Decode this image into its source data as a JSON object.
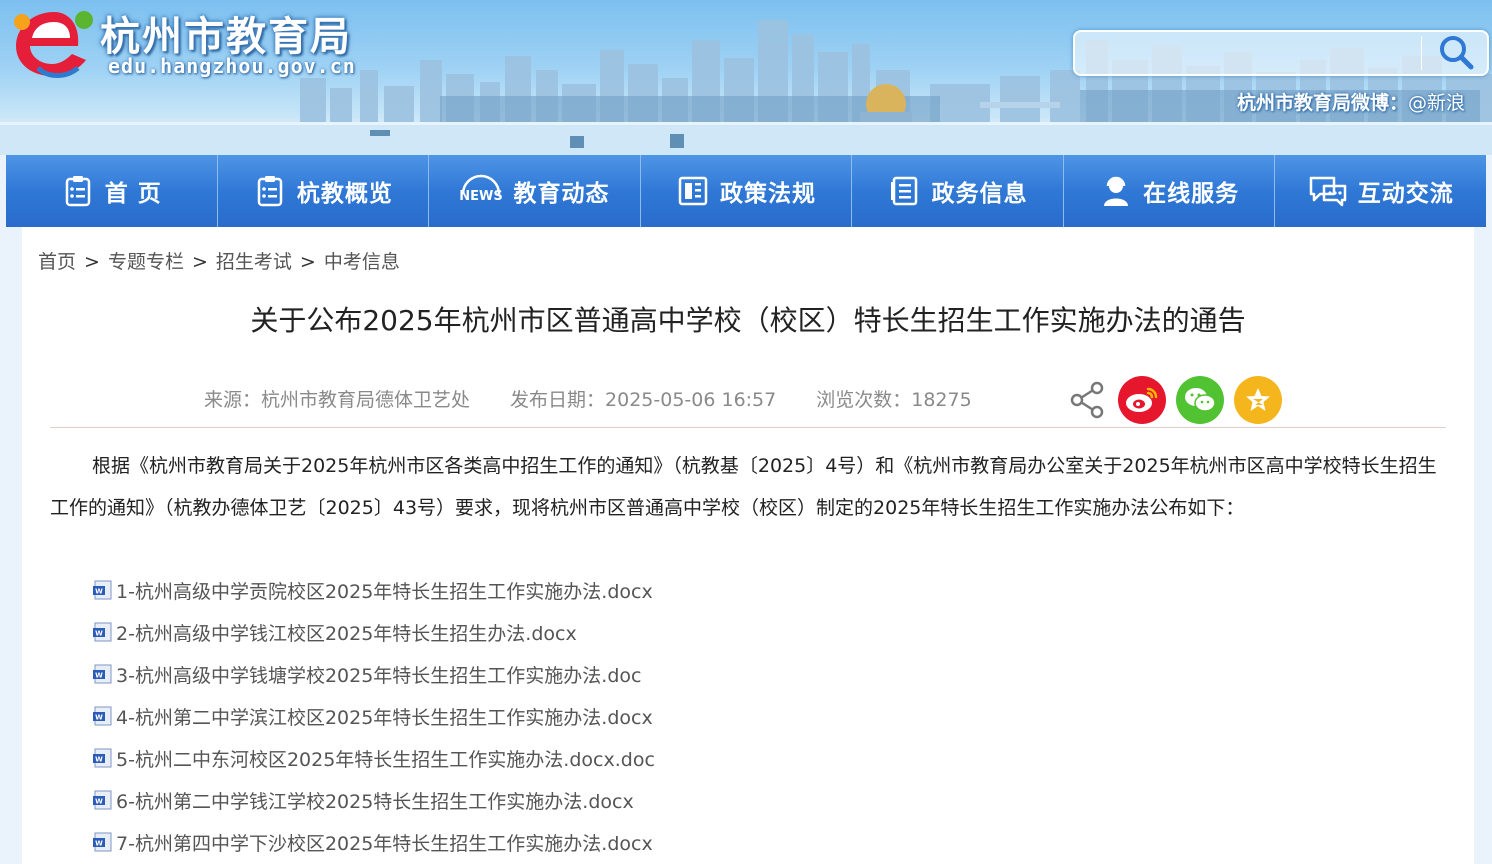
{
  "header": {
    "site_title": "杭州市教育局",
    "site_domain": "edu.hangzhou.gov.cn",
    "weibo_label": "杭州市教育局微博：",
    "weibo_handle": "@新浪",
    "search": {
      "value": "",
      "placeholder": ""
    }
  },
  "nav": [
    {
      "label": "首 页",
      "icon": "clipboard-icon"
    },
    {
      "label": "杭教概览",
      "icon": "clipboard-icon"
    },
    {
      "label": "教育动态",
      "icon": "news-icon"
    },
    {
      "label": "政策法规",
      "icon": "document-grid-icon"
    },
    {
      "label": "政务信息",
      "icon": "list-icon"
    },
    {
      "label": "在线服务",
      "icon": "headset-user-icon"
    },
    {
      "label": "互动交流",
      "icon": "chat-bubbles-icon"
    }
  ],
  "breadcrumb": [
    "首页",
    "专题专栏",
    "招生考试",
    "中考信息"
  ],
  "article": {
    "title": "关于公布2025年杭州市区普通高中学校（校区）特长生招生工作实施办法的通告",
    "source": "来源：杭州市教育局德体卫艺处",
    "date": "发布日期：2025-05-06 16:57",
    "views": "浏览次数：18275",
    "body": "根据《杭州市教育局关于2025年杭州市区各类高中招生工作的通知》（杭教基〔2025〕4号）和《杭州市教育局办公室关于2025年杭州市区高中学校特长生招生工作的通知》（杭教办德体卫艺〔2025〕43号）要求，现将杭州市区普通高中学校（校区）制定的2025年特长生招生工作实施办法公布如下：",
    "attachments": [
      "1-杭州高级中学贡院校区2025年特长生招生工作实施办法.docx",
      "2-杭州高级中学钱江校区2025年特长生招生办法.docx",
      "3-杭州高级中学钱塘学校2025年特长生招生工作实施办法.doc",
      "4-杭州第二中学滨江校区2025年特长生招生工作实施办法.docx",
      "5-杭州二中东河校区2025年特长生招生工作实施办法.docx.doc",
      "6-杭州第二中学钱江学校2025特长生招生工作实施办法.docx",
      "7-杭州第四中学下沙校区2025年特长生招生工作实施办法.docx"
    ]
  },
  "share": [
    {
      "icon": "share-icon",
      "color": "#777777"
    },
    {
      "icon": "weibo-icon",
      "color": "#e6162d"
    },
    {
      "icon": "wechat-icon",
      "color": "#51c332"
    },
    {
      "icon": "qzone-star-icon",
      "color": "#f5b51c"
    }
  ],
  "colors": {
    "nav_blue": "#2f78d6",
    "banner_sky": "#9fd2f4"
  }
}
